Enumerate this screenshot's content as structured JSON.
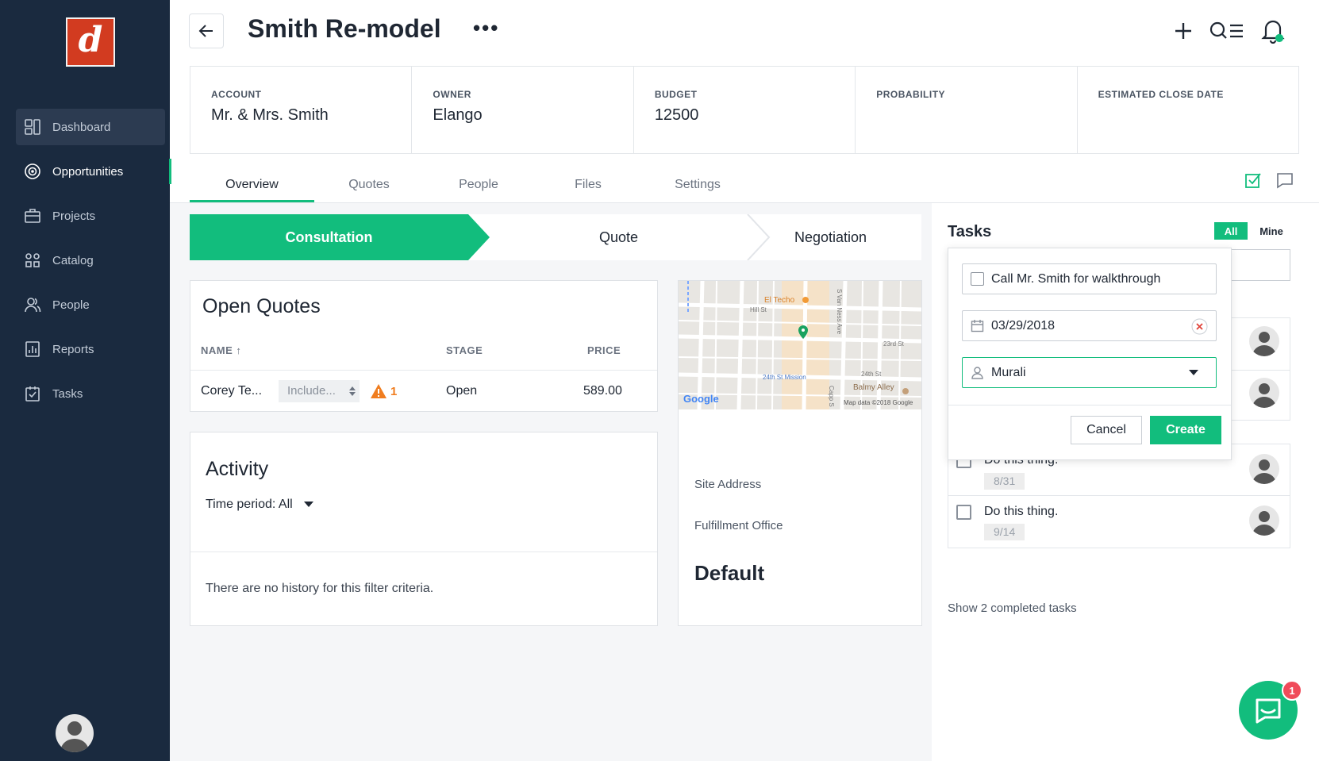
{
  "app": {
    "logo_letter": "d"
  },
  "sidebar": {
    "items": [
      {
        "label": "Dashboard",
        "icon": "dashboard-icon"
      },
      {
        "label": "Opportunities",
        "icon": "target-icon"
      },
      {
        "label": "Projects",
        "icon": "briefcase-icon"
      },
      {
        "label": "Catalog",
        "icon": "catalog-icon"
      },
      {
        "label": "People",
        "icon": "people-icon"
      },
      {
        "label": "Reports",
        "icon": "reports-icon"
      },
      {
        "label": "Tasks",
        "icon": "tasks-icon"
      }
    ],
    "active_item": "Opportunities"
  },
  "header": {
    "title": "Smith Re-model",
    "more": "•••",
    "icons": [
      "add-icon",
      "search-filter-icon",
      "notification-bell-icon"
    ]
  },
  "summary": {
    "account_label": "ACCOUNT",
    "account_value": "Mr. & Mrs. Smith",
    "owner_label": "OWNER",
    "owner_value": "Elango",
    "budget_label": "BUDGET",
    "budget_value": "12500",
    "probability_label": "PROBABILITY",
    "probability_value": "",
    "close_label": "ESTIMATED CLOSE DATE",
    "close_value": ""
  },
  "tabs": [
    {
      "label": "Overview",
      "active": true
    },
    {
      "label": "Quotes"
    },
    {
      "label": "People"
    },
    {
      "label": "Files"
    },
    {
      "label": "Settings"
    }
  ],
  "pipeline": {
    "stages": [
      "Consultation",
      "Quote",
      "Negotiation"
    ],
    "current": "Consultation"
  },
  "open_quotes": {
    "title": "Open Quotes",
    "columns": {
      "name": "NAME ↑",
      "stage": "STAGE",
      "price": "PRICE"
    },
    "rows": [
      {
        "name": "Corey Te...",
        "include": "Include...",
        "warning_count": "1",
        "stage": "Open",
        "price": "589.00"
      }
    ]
  },
  "activity": {
    "title": "Activity",
    "period_label": "Time period:",
    "period_value": "All",
    "empty": "There are no history for this filter criteria."
  },
  "site": {
    "map_labels": {
      "el_techo": "El Techo",
      "hill_st": "Hill St",
      "van_ness": "S Van Ness Ave",
      "st_23rd": "23rd St",
      "st_24th": "24th St",
      "mission": "24th St Mission",
      "balmy": "Balmy Alley",
      "capp": "Capp S",
      "google": "Google",
      "map_data": "Map data ©2018 Google"
    },
    "address_label": "Site Address",
    "office_label": "Fulfillment Office",
    "office_value": "Default"
  },
  "tasks": {
    "title": "Tasks",
    "filter_all": "All",
    "filter_mine": "Mine",
    "new_task": {
      "title_value": "Call Mr. Smith for walkthrough",
      "date_value": "03/29/2018",
      "assignee_value": "Murali",
      "cancel_label": "Cancel",
      "create_label": "Create"
    },
    "items": [
      {
        "text": "Do this thing.",
        "date": "8/31"
      },
      {
        "text": "Do this thing.",
        "date": "9/14"
      }
    ],
    "show_completed": "Show 2 completed tasks"
  },
  "chat": {
    "badge": "1"
  },
  "colors": {
    "accent": "#12bd7d",
    "sidebar": "#1a2a3f",
    "logo": "#d23b20",
    "warning": "#f07d1f",
    "badge": "#f04b5a"
  }
}
